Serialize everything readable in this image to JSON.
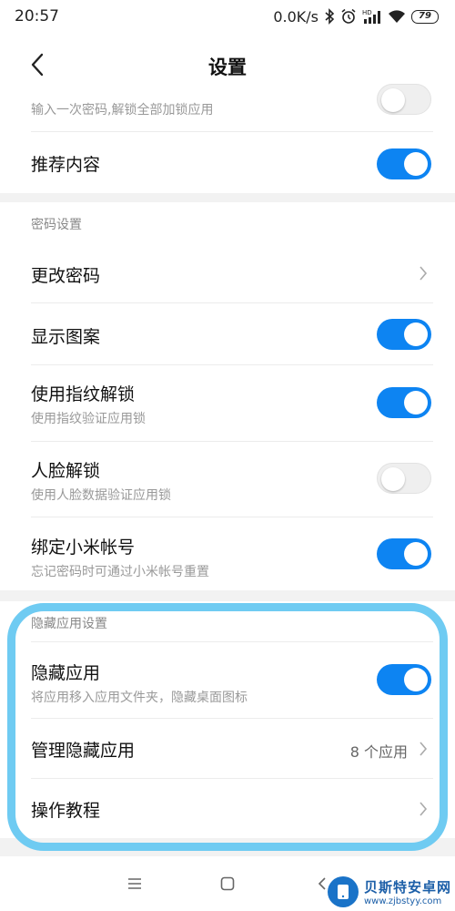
{
  "status_bar": {
    "time": "20:57",
    "net_speed": "0.0K/s",
    "battery": "79",
    "icons": [
      "bluetooth-icon",
      "alarm-icon",
      "hd-signal-icon",
      "wifi-icon",
      "battery-icon"
    ]
  },
  "header": {
    "title": "设置",
    "back_icon": "chevron-left-icon"
  },
  "sections": {
    "top": {
      "partial_sub": "输入一次密码,解锁全部加锁应用",
      "recommend": {
        "label": "推荐内容",
        "enabled": true
      }
    },
    "password": {
      "header": "密码设置",
      "change_password": {
        "label": "更改密码"
      },
      "show_pattern": {
        "label": "显示图案",
        "enabled": true
      },
      "fingerprint": {
        "label": "使用指纹解锁",
        "sub": "使用指纹验证应用锁",
        "enabled": true
      },
      "face": {
        "label": "人脸解锁",
        "sub": "使用人脸数据验证应用锁",
        "enabled": false
      },
      "bind_account": {
        "label": "绑定小米帐号",
        "sub": "忘记密码时可通过小米帐号重置",
        "enabled": true
      }
    },
    "hidden_apps": {
      "header": "隐藏应用设置",
      "hide_apps": {
        "label": "隐藏应用",
        "sub": "将应用移入应用文件夹，隐藏桌面图标",
        "enabled": true
      },
      "manage_hidden": {
        "label": "管理隐藏应用",
        "value": "8 个应用"
      },
      "tutorial": {
        "label": "操作教程"
      }
    }
  },
  "nav_bar": {
    "icons": [
      "menu-icon",
      "home-icon",
      "back-icon"
    ]
  },
  "watermark": {
    "title": "贝斯特安卓网",
    "url": "www.zjbstyy.com"
  },
  "colors": {
    "toggle_on": "#0d84f2",
    "highlight": "#6fcbf2"
  }
}
